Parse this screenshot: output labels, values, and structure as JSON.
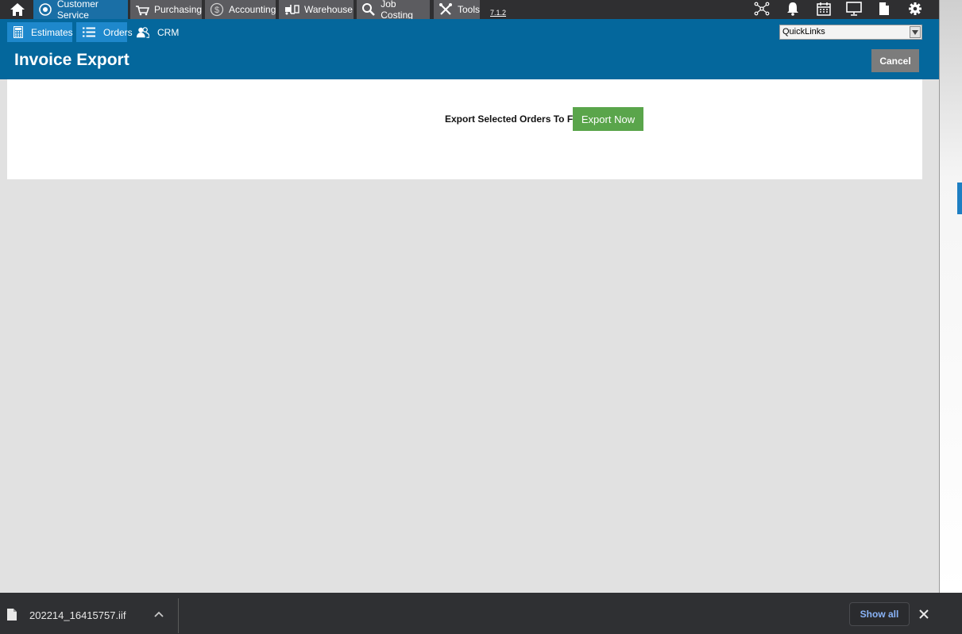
{
  "topnav": {
    "items": [
      {
        "label": "Customer Service",
        "icon": "customer-service-icon"
      },
      {
        "label": "Purchasing",
        "icon": "basket-icon"
      },
      {
        "label": "Accounting",
        "icon": "dollar-icon"
      },
      {
        "label": "Warehouse",
        "icon": "forklift-icon"
      },
      {
        "label": "Job Costing",
        "icon": "magnifier-icon"
      },
      {
        "label": "Tools",
        "icon": "tools-icon"
      }
    ],
    "version": "7.1.2",
    "right_icons": [
      "network-icon",
      "bell-icon",
      "calendar-icon",
      "monitor-icon",
      "document-icon",
      "gear-icon"
    ]
  },
  "subnav": {
    "items": [
      {
        "label": "Estimates",
        "icon": "calculator-icon"
      },
      {
        "label": "Orders",
        "icon": "list-icon"
      },
      {
        "label": "CRM",
        "icon": "people-icon"
      }
    ]
  },
  "quicklinks": {
    "selected": "QuickLinks"
  },
  "page": {
    "title": "Invoice Export",
    "cancel_label": "Cancel"
  },
  "export": {
    "label": "Export Selected Orders To File",
    "button_label": "Export Now"
  },
  "download_bar": {
    "filename": "202214_16415757.iif",
    "show_all_label": "Show all"
  },
  "colors": {
    "nav_bg": "#2f2f31",
    "header_bg": "#04679c",
    "active_tab": "#1a6fa6",
    "export_green": "#5aa54b",
    "cancel_gray": "#7c7c7c"
  }
}
